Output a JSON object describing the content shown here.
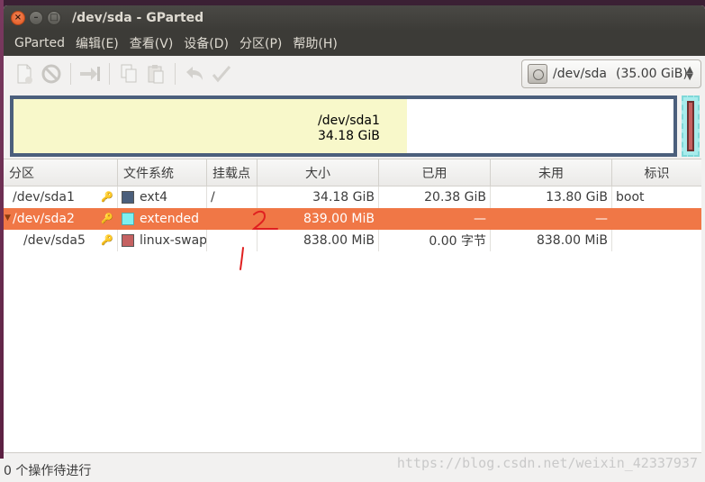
{
  "window": {
    "title": "/dev/sda - GParted"
  },
  "window_controls": {
    "close": "×",
    "minimize": "–",
    "maximize": "□"
  },
  "menu": [
    "GParted",
    "编辑(E)",
    "查看(V)",
    "设备(D)",
    "分区(P)",
    "帮助(H)"
  ],
  "toolbar": {
    "icons": [
      "new-partition-icon",
      "delete-icon",
      "resize-move-icon",
      "copy-icon",
      "paste-icon",
      "undo-icon",
      "apply-icon"
    ],
    "device_path": "/dev/sda",
    "device_size": "(35.00 GiB)"
  },
  "diskmap": {
    "label_name": "/dev/sda1",
    "label_size": "34.18 GiB"
  },
  "table": {
    "headers": [
      "分区",
      "文件系统",
      "挂载点",
      "大小",
      "已用",
      "未用",
      "标识"
    ],
    "rows": [
      {
        "partition": "/dev/sda1",
        "fs": "ext4",
        "fs_color": "#4b5f7c",
        "mount": "/",
        "size": "34.18 GiB",
        "used": "20.38 GiB",
        "unused": "13.80 GiB",
        "flags": "boot"
      },
      {
        "partition": "/dev/sda2",
        "fs": "extended",
        "fs_color": "#7ef0f0",
        "mount": "",
        "size": "839.00 MiB",
        "used": "—",
        "unused": "—",
        "flags": ""
      },
      {
        "partition": "/dev/sda5",
        "fs": "linux-swap",
        "fs_color": "#c56161",
        "mount": "",
        "size": "838.00 MiB",
        "used": "0.00 字节",
        "unused": "838.00 MiB",
        "flags": ""
      }
    ]
  },
  "status": {
    "text": "0 个操作待进行"
  },
  "watermark": "https://blog.csdn.net/weixin_42337937",
  "colors": {
    "selection": "#f07746",
    "accent": "#e0561d"
  }
}
